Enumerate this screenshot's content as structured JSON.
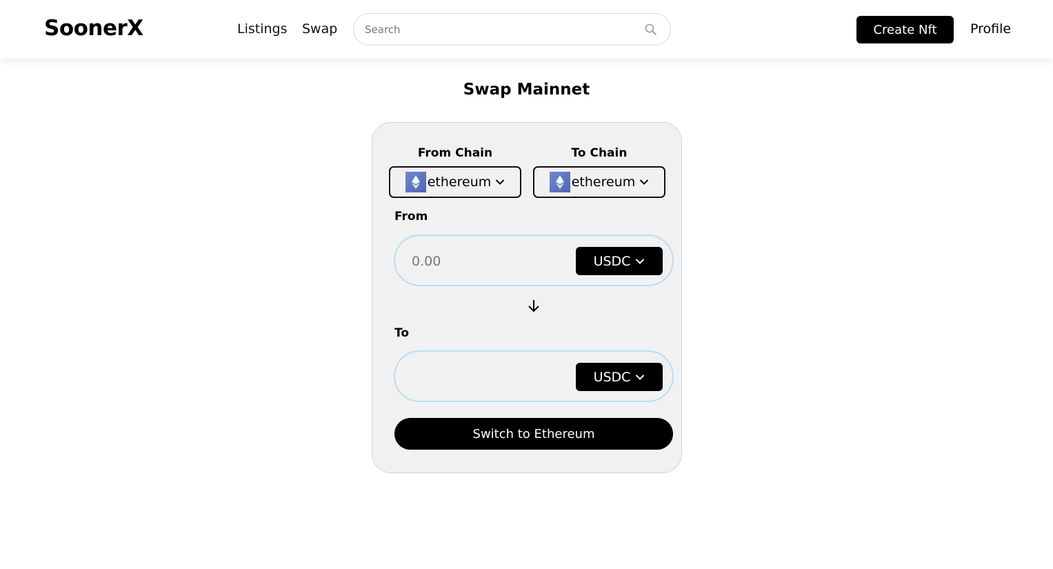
{
  "header": {
    "brand": "SoonerX",
    "nav": [
      {
        "label": "Listings"
      },
      {
        "label": "Swap"
      }
    ],
    "search_placeholder": "Search",
    "create_label": "Create Nft",
    "profile_label": "Profile"
  },
  "swap": {
    "title": "Swap Mainnet",
    "from_chain_label": "From Chain",
    "to_chain_label": "To Chain",
    "from_chain_value": "ethereum",
    "to_chain_value": "ethereum",
    "from_label": "From",
    "to_label": "To",
    "from_amount_placeholder": "0.00",
    "from_token": "USDC",
    "to_token": "USDC",
    "switch_button": "Switch to Ethereum"
  },
  "colors": {
    "accent": "#000000",
    "card_border": "#b9dcf0",
    "card_bg": "#f1f1f1",
    "eth_badge": "#627eea"
  },
  "icons": {
    "search": "search-icon",
    "chain": "ethereum-icon",
    "dropdown": "chevron-down-icon",
    "swap_direction": "arrow-down-icon"
  }
}
